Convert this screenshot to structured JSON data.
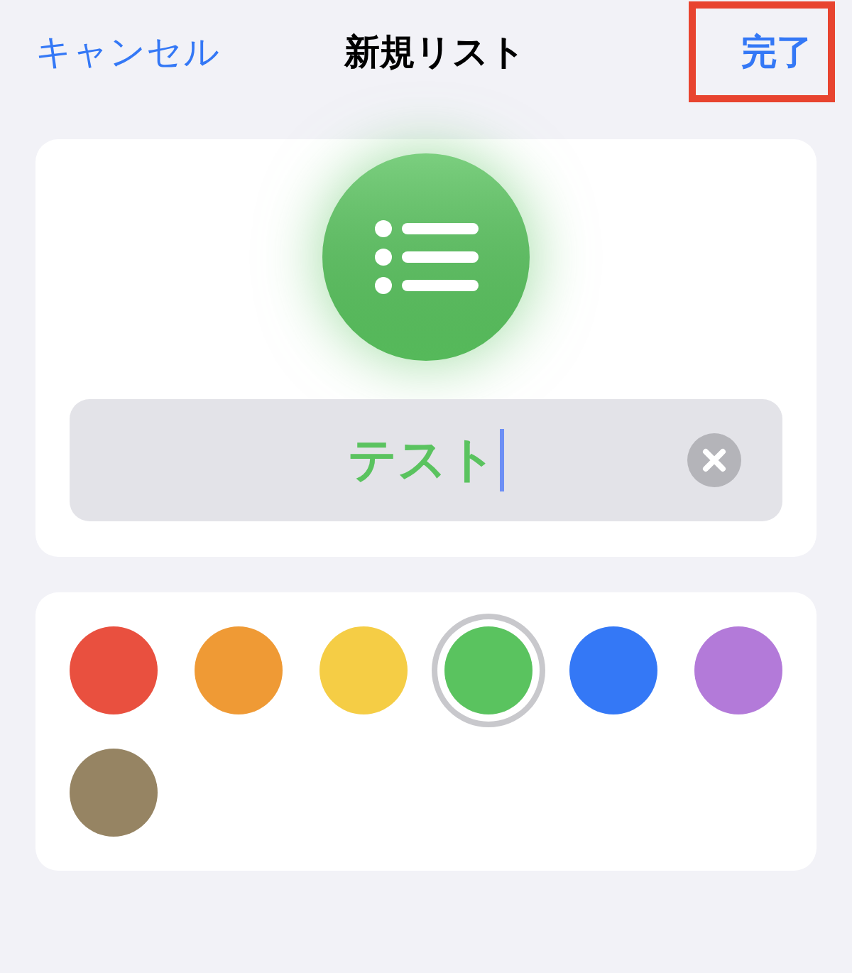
{
  "nav_bar": {
    "cancel": "キャンセル",
    "title": "新規リスト",
    "done": {
      "label": "完了",
      "highlighted": true
    }
  },
  "list_icon": {
    "color": "#5ac35f"
  },
  "name_field": {
    "value": "テスト",
    "focused": true
  },
  "colors": [
    {
      "color": "#e9503f",
      "selected": false
    },
    {
      "color": "#ef9a35",
      "selected": false
    },
    {
      "color": "#f5cd45",
      "selected": false
    },
    {
      "color": "#5ac35f",
      "selected": true
    },
    {
      "color": "#3478f6",
      "selected": false
    },
    {
      "color": "#b37ad9",
      "selected": false
    },
    {
      "color": "#968463",
      "selected": false
    }
  ]
}
